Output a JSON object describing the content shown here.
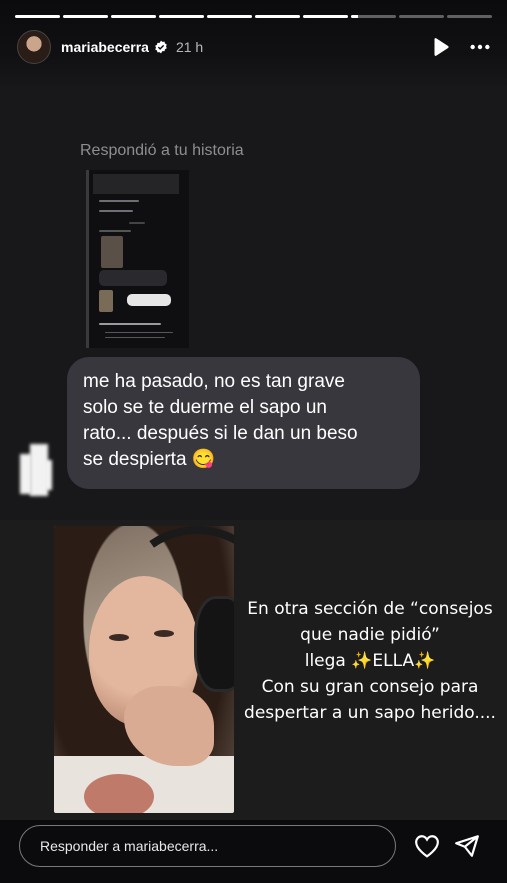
{
  "story": {
    "progress_segments": [
      1,
      1,
      1,
      1,
      1,
      1,
      1,
      0.15,
      0,
      0
    ]
  },
  "header": {
    "username": "mariabecerra",
    "verified_icon": "verified-badge-icon",
    "time": "21 h",
    "play_icon": "play-icon",
    "more_icon": "more-options-icon"
  },
  "reply_card": {
    "label": "Respondió a tu historia",
    "message": "me ha pasado, no es tan grave\nsolo se te duerme el sapo un\nrato... después si le dan un beso\nse despierta 😋"
  },
  "overlay_text": {
    "lines": [
      "En otra sección de “consejos",
      "que nadie pidió”",
      "llega ✨ELLA✨",
      "Con su gran consejo para",
      "despertar a un sapo herido...."
    ]
  },
  "footer": {
    "reply_placeholder": "Responder a mariabecerra...",
    "heart_icon": "heart-icon",
    "send_icon": "send-icon"
  },
  "colors": {
    "background": "#0b0b0d",
    "bubble": "#38373d",
    "label_gray": "#8e8e92"
  }
}
